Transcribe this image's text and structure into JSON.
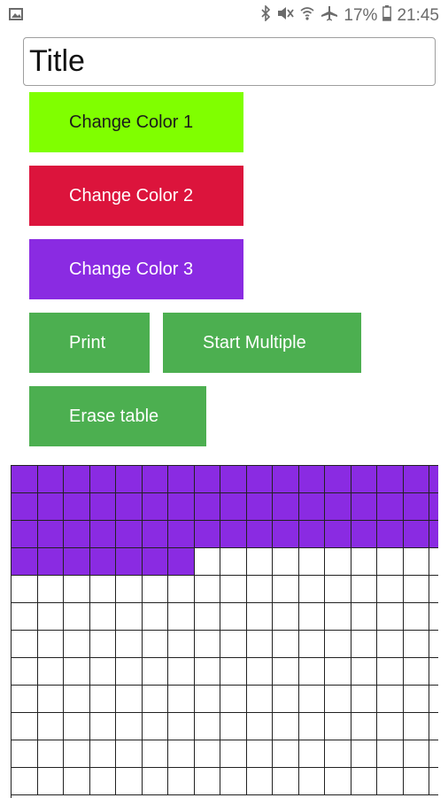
{
  "status": {
    "battery": "17%",
    "time": "21:45"
  },
  "title_field": {
    "value": "Title"
  },
  "buttons": {
    "change_color_1": "Change Color 1",
    "change_color_2": "Change Color 2",
    "change_color_3": "Change Color 3",
    "print": "Print",
    "start_multiple": "Start Multiple",
    "erase_table": "Erase table"
  },
  "colors": {
    "color1": "#80ff00",
    "color2": "#dc143c",
    "color3": "#8a2be2",
    "action_buttons": "#4caf50",
    "grid_line": "#222222"
  },
  "table": {
    "columns": 17,
    "visible_rows": 12,
    "filled_cells": 58,
    "fill_color": "#8a2be2"
  }
}
